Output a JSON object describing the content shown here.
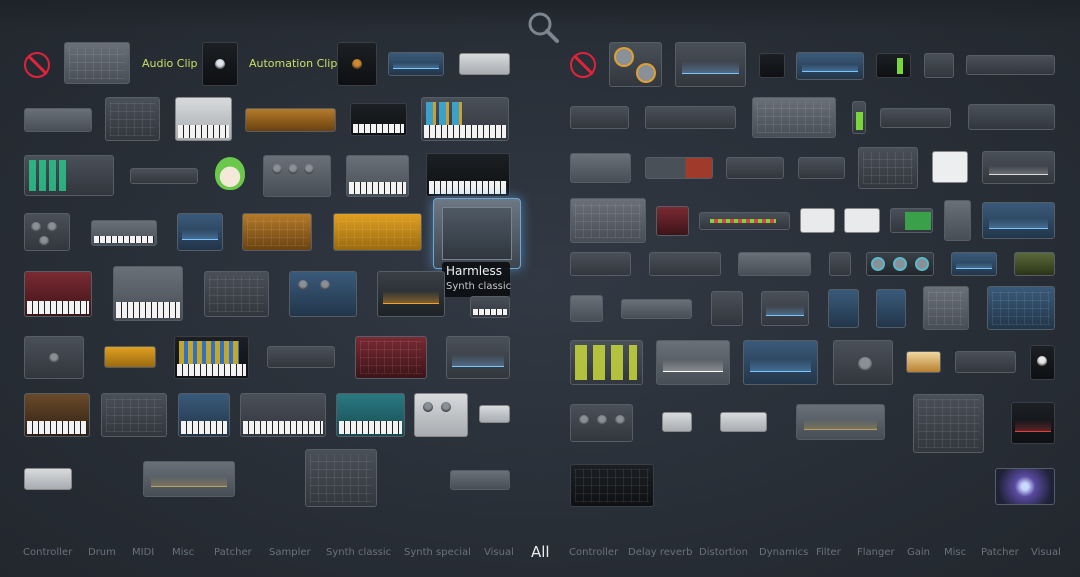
{
  "browser": {
    "search_icon": "magnifier-icon",
    "hovered_plugin": {
      "name": "Harmless",
      "category": "Synth classic"
    }
  },
  "generators": {
    "audio_clip_label": "Audio Clip",
    "automation_clip_label": "Automation Clip"
  },
  "category_tabs": {
    "generators": [
      "Controller",
      "Drum",
      "MIDI",
      "Misc",
      "Patcher",
      "Sampler",
      "Synth classic",
      "Synth special",
      "Visual"
    ],
    "all_label": "All",
    "effects": [
      "Controller",
      "Delay reverb",
      "Distortion",
      "Dynamics",
      "Filter",
      "Flanger",
      "Gain",
      "Misc",
      "Patcher",
      "Visual"
    ],
    "active": "All"
  },
  "colors": {
    "background": "#2a3038",
    "clip_label": "#c8e066",
    "no_plugin_red": "#e0233a",
    "hover_glow": "#6aa8d8",
    "tab_text": "#69727c",
    "tab_active": "#e8eaec"
  }
}
